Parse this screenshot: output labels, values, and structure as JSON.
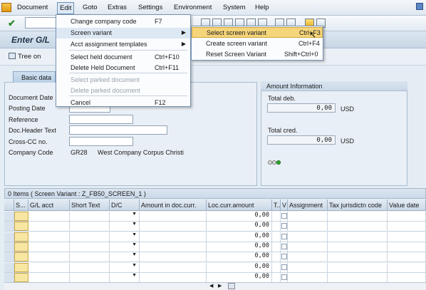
{
  "menubar": {
    "items": [
      "Document",
      "Edit",
      "Goto",
      "Extras",
      "Settings",
      "Environment",
      "System",
      "Help"
    ]
  },
  "title": {
    "text": "Enter G/L"
  },
  "app_toolbar": {
    "tree_on": "Tree on"
  },
  "tabs": {
    "basic_data": "Basic data"
  },
  "form": {
    "document_date_label": "Document Date",
    "posting_date_label": "Posting Date",
    "reference_label": "Reference",
    "doc_header_text_label": "Doc.Header Text",
    "cross_cc_label": "Cross-CC no.",
    "company_code_label": "Company Code",
    "company_code_value": "GR28",
    "company_name": "West Company Corpus Christi"
  },
  "amount": {
    "header": "Amount Information",
    "total_deb_label": "Total deb.",
    "total_deb_value": "0,00",
    "total_deb_currency": "USD",
    "total_cred_label": "Total cred.",
    "total_cred_value": "0,00",
    "total_cred_currency": "USD"
  },
  "items": {
    "title": "0 Items ( Screen Variant : Z_FB50_SCREEN_1 )",
    "columns": [
      "S...",
      "G/L acct",
      "Short Text",
      "D/C",
      "Amount in doc.curr.",
      "Loc.curr.amount",
      "T..",
      "V",
      "Assignment",
      "Tax jurisdictn code",
      "Value date"
    ],
    "row_value": "0,00"
  },
  "edit_menu": {
    "items": [
      {
        "label": "Change company code",
        "shortcut": "F7",
        "disabled": false
      },
      {
        "label": "Screen variant",
        "shortcut": "",
        "disabled": false,
        "submenu": true
      },
      {
        "label": "Acct assignment templates",
        "shortcut": "",
        "disabled": false,
        "submenu": true
      },
      {
        "label": "Select held document",
        "shortcut": "Ctrl+F10",
        "disabled": false
      },
      {
        "label": "Delete Held Document",
        "shortcut": "Ctrl+F11",
        "disabled": false
      },
      {
        "label": "Select parked document",
        "shortcut": "",
        "disabled": true
      },
      {
        "label": "Delete parked document",
        "shortcut": "",
        "disabled": true
      },
      {
        "label": "Cancel",
        "shortcut": "F12",
        "disabled": false
      }
    ]
  },
  "screen_variant_menu": {
    "items": [
      {
        "label": "Select screen variant",
        "shortcut": "Ctrl+F3"
      },
      {
        "label": "Create screen variant",
        "shortcut": "Ctrl+F4"
      },
      {
        "label": "Reset Screen Variant",
        "shortcut": "Shift+Ctrl+0"
      }
    ]
  },
  "colors": {
    "highlight": "#f5d57a",
    "menu_border": "#7893b2",
    "panel": "#e9eff6"
  }
}
